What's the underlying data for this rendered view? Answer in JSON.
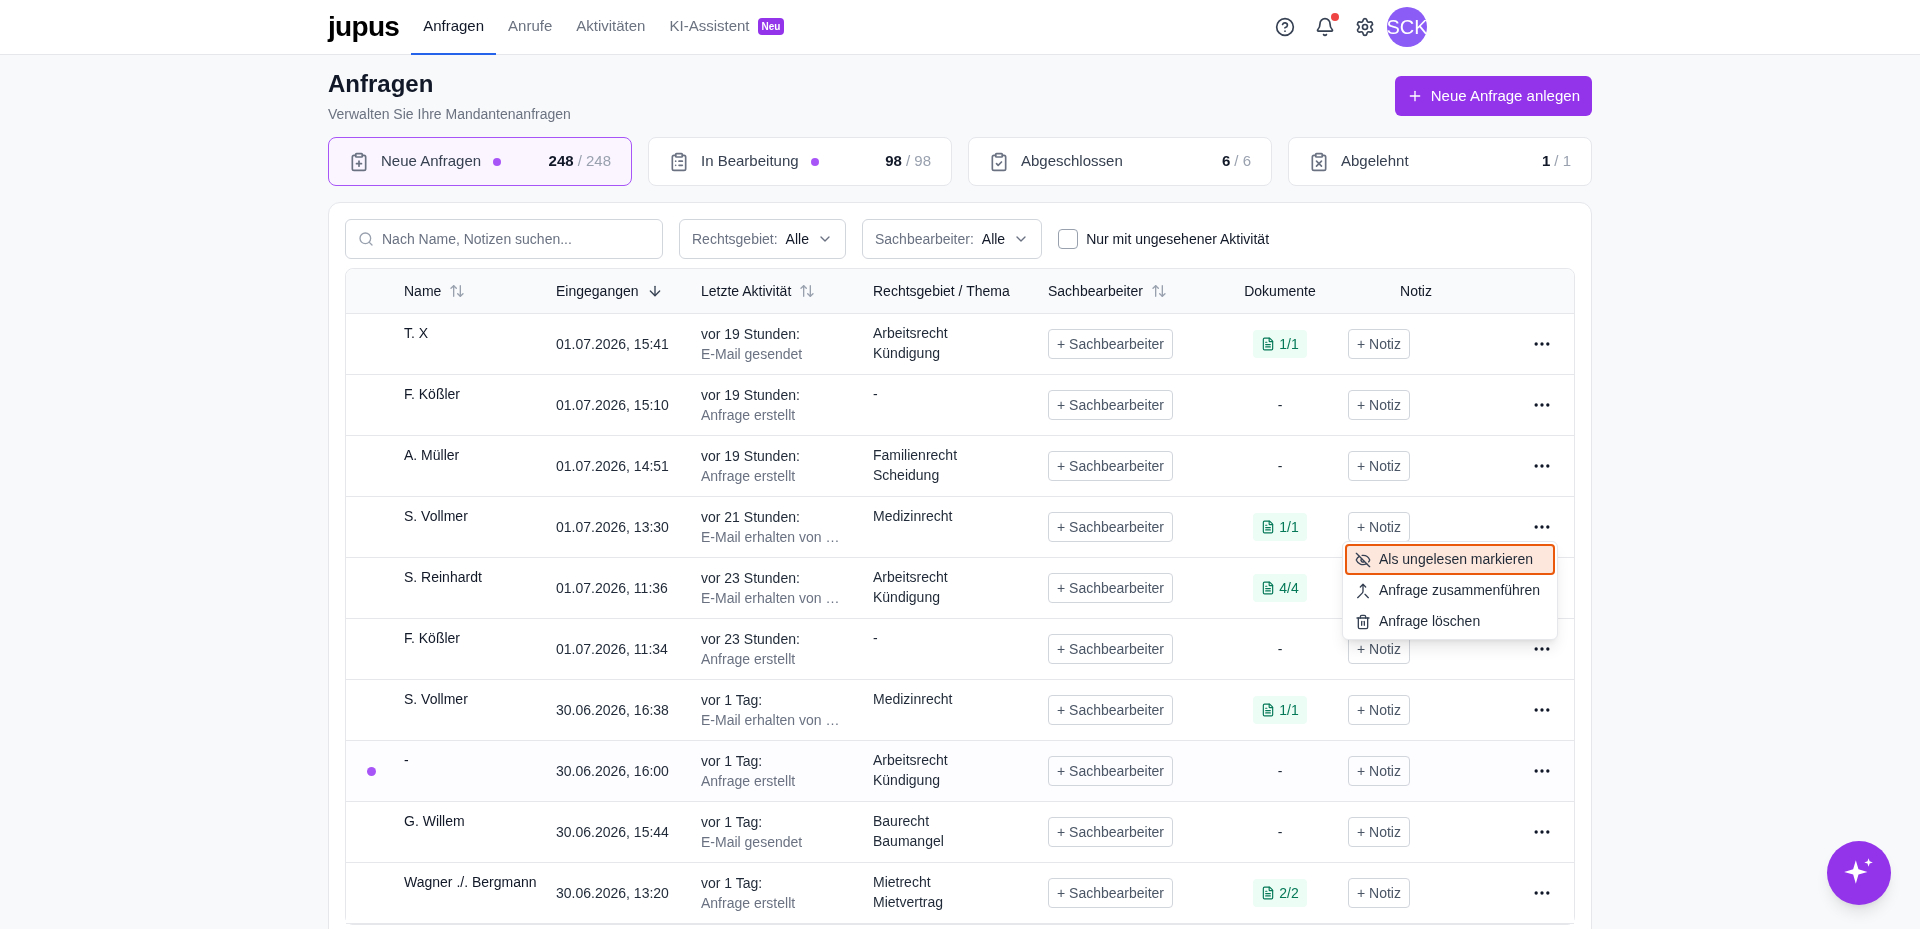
{
  "header": {
    "logo": "jupus",
    "nav": [
      {
        "label": "Anfragen",
        "selected": true
      },
      {
        "label": "Anrufe",
        "selected": false
      },
      {
        "label": "Aktivitäten",
        "selected": false
      },
      {
        "label": "KI-Assistent",
        "selected": false,
        "badge": "Neu"
      }
    ],
    "notifications_unread": true,
    "avatar": "SCK"
  },
  "page": {
    "title": "Anfragen",
    "subtitle": "Verwalten Sie Ihre Mandantenanfragen",
    "primary_button": "Neue Anfrage anlegen"
  },
  "status_cards": [
    {
      "kind": "new",
      "label": "Neue Anfragen",
      "dot": true,
      "count": "248",
      "total": "/ 248",
      "selected": true
    },
    {
      "kind": "progress",
      "label": "In Bearbeitung",
      "dot": true,
      "count": "98",
      "total": "/ 98",
      "selected": false
    },
    {
      "kind": "done",
      "label": "Abgeschlossen",
      "dot": false,
      "count": "6",
      "total": "/ 6",
      "selected": false
    },
    {
      "kind": "rejected",
      "label": "Abgelehnt",
      "dot": false,
      "count": "1",
      "total": "/ 1",
      "selected": false
    }
  ],
  "filters": {
    "search_placeholder": "Nach Name, Notizen suchen...",
    "dropdowns": [
      {
        "label": "Rechtsgebiet:",
        "value": "Alle"
      },
      {
        "label": "Sachbearbeiter:",
        "value": "Alle"
      }
    ],
    "checkbox": {
      "label": "Nur mit ungesehener Aktivität",
      "checked": false
    }
  },
  "table": {
    "columns": [
      {
        "label": "Name",
        "sortable": true,
        "sorted": false
      },
      {
        "label": "Eingegangen",
        "sortable": true,
        "sorted": true
      },
      {
        "label": "Letzte Aktivität",
        "sortable": true,
        "sorted": false
      },
      {
        "label": "Rechtsgebiet / Thema",
        "sortable": false,
        "sorted": false
      },
      {
        "label": "Sachbearbeiter",
        "sortable": true,
        "sorted": false
      },
      {
        "label": "Dokumente",
        "sortable": false,
        "sorted": false
      },
      {
        "label": "Notiz",
        "sortable": false,
        "sorted": false
      }
    ],
    "rows": [
      {
        "unread": false,
        "name": "T. X",
        "received": "01.07.2026, 15:41",
        "activity_time": "vor 19 Stunden:",
        "activity": "E-Mail gesendet",
        "area": "Arbeitsrecht",
        "topic": "Kündigung",
        "assignee": "+ Sachbearbeiter",
        "documents": {
          "kind": "badge",
          "text": "1/1"
        },
        "note": "+ Notiz"
      },
      {
        "unread": false,
        "name": "F. Kößler",
        "received": "01.07.2026, 15:10",
        "activity_time": "vor 19 Stunden:",
        "activity": "Anfrage erstellt",
        "area": "-",
        "assignee": "+ Sachbearbeiter",
        "documents": {
          "kind": "none",
          "text": "-"
        },
        "note": "+ Notiz"
      },
      {
        "unread": false,
        "name": "A. Müller",
        "received": "01.07.2026, 14:51",
        "activity_time": "vor 19 Stunden:",
        "activity": "Anfrage erstellt",
        "area": "Familienrecht",
        "topic": "Scheidung",
        "assignee": "+ Sachbearbeiter",
        "documents": {
          "kind": "none",
          "text": "-"
        },
        "note": "+ Notiz"
      },
      {
        "unread": false,
        "name": "S. Vollmer",
        "received": "01.07.2026, 13:30",
        "activity_time": "vor 21 Stunden:",
        "activity": "E-Mail erhalten von …",
        "area": "Medizinrecht",
        "assignee": "+ Sachbearbeiter",
        "documents": {
          "kind": "badge",
          "text": "1/1"
        },
        "note": "+ Notiz",
        "menu": [
          {
            "kind": "unread",
            "label": "Als ungelesen markieren",
            "selected": true
          },
          {
            "kind": "merge",
            "label": "Anfrage zusammenführen",
            "selected": false
          },
          {
            "kind": "delete",
            "label": "Anfrage löschen",
            "selected": false
          }
        ]
      },
      {
        "unread": false,
        "name": "S. Reinhardt",
        "received": "01.07.2026, 11:36",
        "activity_time": "vor 23 Stunden:",
        "activity": "E-Mail erhalten von …",
        "area": "Arbeitsrecht",
        "topic": "Kündigung",
        "assignee": "+ Sachbearbeiter",
        "documents": {
          "kind": "badge",
          "text": "4/4"
        }
      },
      {
        "unread": false,
        "name": "F. Kößler",
        "received": "01.07.2026, 11:34",
        "activity_time": "vor 23 Stunden:",
        "activity": "Anfrage erstellt",
        "area": "-",
        "assignee": "+ Sachbearbeiter",
        "documents": {
          "kind": "none",
          "text": "-"
        },
        "note": "+ Notiz"
      },
      {
        "unread": false,
        "name": "S. Vollmer",
        "received": "30.06.2026, 16:38",
        "activity_time": "vor 1 Tag:",
        "activity": "E-Mail erhalten von …",
        "area": "Medizinrecht",
        "assignee": "+ Sachbearbeiter",
        "documents": {
          "kind": "badge",
          "text": "1/1"
        },
        "note": "+ Notiz"
      },
      {
        "unread": true,
        "name": "-",
        "received": "30.06.2026, 16:00",
        "activity_time": "vor 1 Tag:",
        "activity": "Anfrage erstellt",
        "area": "Arbeitsrecht",
        "topic": "Kündigung",
        "assignee": "+ Sachbearbeiter",
        "documents": {
          "kind": "none",
          "text": "-"
        },
        "note": "+ Notiz"
      },
      {
        "unread": false,
        "name": "G. Willem",
        "received": "30.06.2026, 15:44",
        "activity_time": "vor 1 Tag:",
        "activity": "E-Mail gesendet",
        "area": "Baurecht",
        "topic": "Baumangel",
        "assignee": "+ Sachbearbeiter",
        "documents": {
          "kind": "none",
          "text": "-"
        },
        "note": "+ Notiz"
      },
      {
        "unread": false,
        "name": "Wagner ./. Bergmann",
        "received": "30.06.2026, 13:20",
        "activity_time": "vor 1 Tag:",
        "activity": "Anfrage erstellt",
        "area": "Mietrecht",
        "topic": "Mietvertrag",
        "assignee": "+ Sachbearbeiter",
        "documents": {
          "kind": "badge",
          "text": "2/2"
        },
        "note": "+ Notiz"
      }
    ]
  }
}
